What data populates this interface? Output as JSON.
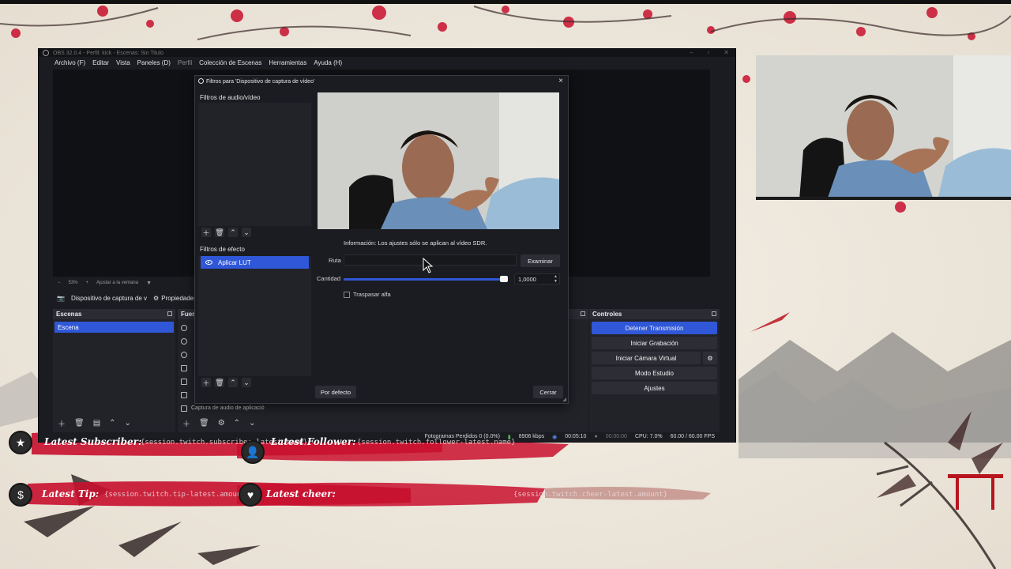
{
  "obs": {
    "title": "OBS 32.0.4 - Perfil: kick - Escenas: Sin Titulo",
    "menu": [
      "Archivo (F)",
      "Editar",
      "Vista",
      "Paneles (D)",
      "Perfil",
      "Colección de Escenas",
      "Herramientas",
      "Ayuda (H)"
    ],
    "zoom": {
      "minus": "−",
      "value": "53%",
      "plus": "+",
      "fit": "Ajustar a la ventana"
    },
    "source_bar": {
      "selected_source": "Dispositivo de captura de v",
      "properties": "Propiedades"
    },
    "scenes": {
      "title": "Escenas",
      "items": [
        "Escena"
      ]
    },
    "sources": {
      "title": "Fuen",
      "last_item": "Captura de audio de aplicació"
    },
    "controls": {
      "title": "Controles",
      "stop_stream": "Detener Transmisión",
      "start_recording": "Iniciar Grabación",
      "start_virtual_cam": "Iniciar Cámara Virtual",
      "studio_mode": "Modo Estudio",
      "settings": "Ajustes"
    },
    "status": {
      "dropped_frames": "Fotogramas Perdidos 0 (0.0%)",
      "bitrate": "8906 kbps",
      "stream_time": "00:05:10",
      "rec_time": "00:00:00",
      "cpu": "CPU: 7.0%",
      "fps": "60.00 / 60.00 FPS"
    }
  },
  "dialog": {
    "title": "Filtros para 'Dispositivo de captura de vídeo'",
    "audio_video_filters_label": "Filtros de audio/vídeo",
    "effect_filters_label": "Filtros de efecto",
    "effect_filters": [
      {
        "name": "Aplicar LUT",
        "visible": true
      }
    ],
    "info": "Información: Los ajustes sólo se aplican al vídeo SDR.",
    "path_label": "Ruta",
    "path_value": "",
    "browse": "Examinar",
    "amount_label": "Cantidad",
    "amount_value": "1,0000",
    "amount_fraction": 1.0,
    "alpha_label": "Traspasar alfa",
    "alpha_checked": false,
    "defaults": "Por defecto",
    "close": "Cerrar"
  },
  "alerts": {
    "subscriber_label": "Latest Subscriber:",
    "subscriber_value": "{session.twitch.subscriber-latest.name}",
    "follower_label": "Latest Follower:",
    "follower_value": "{session.twitch.follower-latest.name}",
    "tip_label": "Latest Tip:",
    "tip_value": "{session.twitch.tip-latest.amount}",
    "cheer_label": "Latest cheer:",
    "cheer_value": "{session.twitch.cheer-latest.amount}"
  },
  "colors": {
    "accent": "#2f57d8",
    "ink_red": "#c8102e",
    "obs_bg": "#1b1c21"
  },
  "icons": [
    "star-icon",
    "user-add-icon",
    "dollar-icon",
    "cheer-icon",
    "eye-icon",
    "camera-icon",
    "gear-icon"
  ]
}
